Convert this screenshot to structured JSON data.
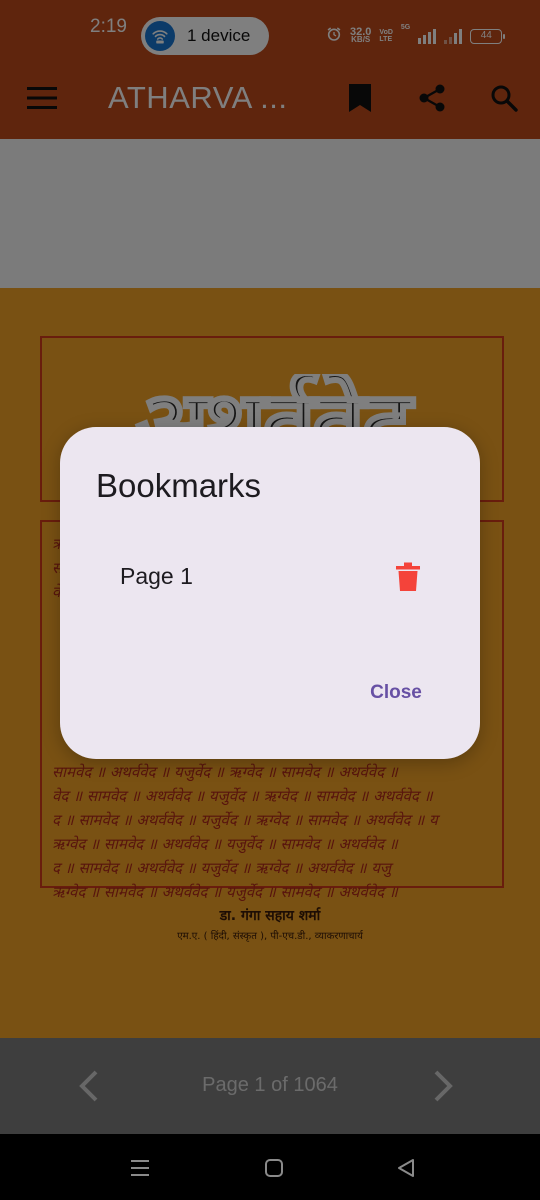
{
  "status_bar": {
    "time": "2:19",
    "hotspot_label": "1 device",
    "net_speed_value": "32.0",
    "net_speed_unit": "KB/S",
    "volte_top": "VoD",
    "volte_bottom": "LTE",
    "network_type": "5G",
    "battery_level": "44"
  },
  "toolbar": {
    "title": "ATHARVA ...",
    "icons": [
      "menu-icon",
      "bookmark-icon",
      "share-icon",
      "search-icon"
    ]
  },
  "pager": {
    "indicator": "Page 1 of 1064"
  },
  "dialog": {
    "title": "Bookmarks",
    "items": [
      {
        "label": "Page 1"
      }
    ],
    "close_label": "Close"
  },
  "colors": {
    "app_bar": "#BF4A1B",
    "dialog_surface": "#ECE6F0",
    "delete_icon": "#F4433A",
    "close_text": "#6750A4",
    "cover_background": "#F3A326"
  }
}
